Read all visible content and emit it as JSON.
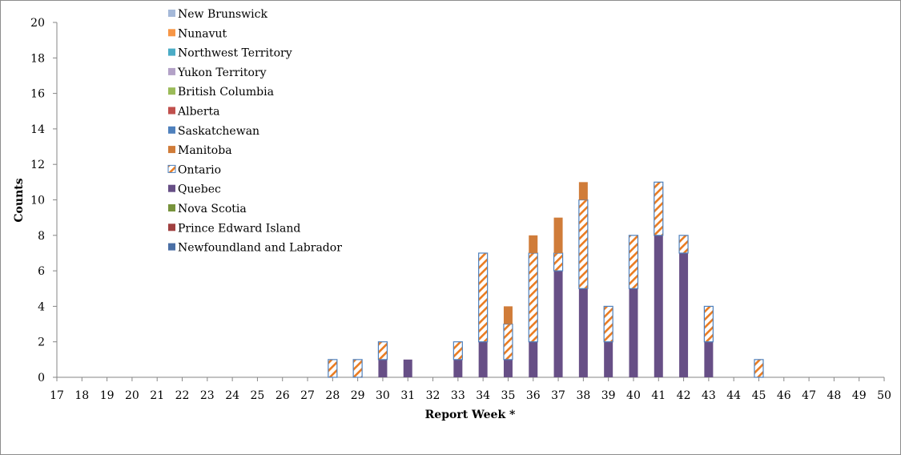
{
  "chart_data": {
    "type": "bar",
    "stacked": true,
    "title": "",
    "xlabel": "Report Week *",
    "ylabel": "Counts",
    "ylim": [
      0,
      20
    ],
    "yticks": [
      0,
      2,
      4,
      6,
      8,
      10,
      12,
      14,
      16,
      18,
      20
    ],
    "grid": false,
    "legend_position": "top-left",
    "categories": [
      "17",
      "18",
      "19",
      "20",
      "21",
      "22",
      "23",
      "24",
      "25",
      "26",
      "27",
      "28",
      "29",
      "30",
      "31",
      "32",
      "33",
      "34",
      "35",
      "36",
      "37",
      "38",
      "39",
      "40",
      "41",
      "42",
      "43",
      "44",
      "45",
      "46",
      "47",
      "48",
      "49",
      "50"
    ],
    "series": [
      {
        "name": "Newfoundland and Labrador",
        "color": "#4a6fa5",
        "pattern": "solid",
        "values": [
          0,
          0,
          0,
          0,
          0,
          0,
          0,
          0,
          0,
          0,
          0,
          0,
          0,
          0,
          0,
          0,
          0,
          0,
          0,
          0,
          0,
          0,
          0,
          0,
          0,
          0,
          0,
          0,
          0,
          0,
          0,
          0,
          0,
          0
        ]
      },
      {
        "name": "Prince Edward Island",
        "color": "#a04040",
        "pattern": "solid",
        "values": [
          0,
          0,
          0,
          0,
          0,
          0,
          0,
          0,
          0,
          0,
          0,
          0,
          0,
          0,
          0,
          0,
          0,
          0,
          0,
          0,
          0,
          0,
          0,
          0,
          0,
          0,
          0,
          0,
          0,
          0,
          0,
          0,
          0,
          0
        ]
      },
      {
        "name": "Nova Scotia",
        "color": "#77933c",
        "pattern": "solid",
        "values": [
          0,
          0,
          0,
          0,
          0,
          0,
          0,
          0,
          0,
          0,
          0,
          0,
          0,
          0,
          0,
          0,
          0,
          0,
          0,
          0,
          0,
          0,
          0,
          0,
          0,
          0,
          0,
          0,
          0,
          0,
          0,
          0,
          0,
          0
        ]
      },
      {
        "name": "Quebec",
        "color": "#674f86",
        "pattern": "solid",
        "values": [
          0,
          0,
          0,
          0,
          0,
          0,
          0,
          0,
          0,
          0,
          0,
          0,
          0,
          1,
          1,
          0,
          1,
          2,
          1,
          2,
          6,
          5,
          2,
          5,
          8,
          7,
          2,
          0,
          0,
          0,
          0,
          0,
          0,
          0
        ]
      },
      {
        "name": "Ontario",
        "color": "#e97c22",
        "pattern": "hatched",
        "border": "#4f81bd",
        "values": [
          0,
          0,
          0,
          0,
          0,
          0,
          0,
          0,
          0,
          0,
          0,
          1,
          1,
          1,
          0,
          0,
          1,
          5,
          2,
          5,
          1,
          5,
          2,
          3,
          3,
          1,
          2,
          0,
          1,
          0,
          0,
          0,
          0,
          0
        ]
      },
      {
        "name": "Manitoba",
        "color": "#d07c39",
        "pattern": "solid",
        "values": [
          0,
          0,
          0,
          0,
          0,
          0,
          0,
          0,
          0,
          0,
          0,
          0,
          0,
          0,
          0,
          0,
          0,
          0,
          1,
          1,
          2,
          1,
          0,
          0,
          0,
          0,
          0,
          0,
          0,
          0,
          0,
          0,
          0,
          0
        ]
      },
      {
        "name": "Saskatchewan",
        "color": "#4f81bd",
        "pattern": "solid",
        "values": [
          0,
          0,
          0,
          0,
          0,
          0,
          0,
          0,
          0,
          0,
          0,
          0,
          0,
          0,
          0,
          0,
          0,
          0,
          0,
          0,
          0,
          0,
          0,
          0,
          0,
          0,
          0,
          0,
          0,
          0,
          0,
          0,
          0,
          0
        ]
      },
      {
        "name": "Alberta",
        "color": "#c0504d",
        "pattern": "solid",
        "values": [
          0,
          0,
          0,
          0,
          0,
          0,
          0,
          0,
          0,
          0,
          0,
          0,
          0,
          0,
          0,
          0,
          0,
          0,
          0,
          0,
          0,
          0,
          0,
          0,
          0,
          0,
          0,
          0,
          0,
          0,
          0,
          0,
          0,
          0
        ]
      },
      {
        "name": "British Columbia",
        "color": "#9bbb59",
        "pattern": "solid",
        "values": [
          0,
          0,
          0,
          0,
          0,
          0,
          0,
          0,
          0,
          0,
          0,
          0,
          0,
          0,
          0,
          0,
          0,
          0,
          0,
          0,
          0,
          0,
          0,
          0,
          0,
          0,
          0,
          0,
          0,
          0,
          0,
          0,
          0,
          0
        ]
      },
      {
        "name": "Yukon Territory",
        "color": "#b3a2c7",
        "pattern": "solid",
        "values": [
          0,
          0,
          0,
          0,
          0,
          0,
          0,
          0,
          0,
          0,
          0,
          0,
          0,
          0,
          0,
          0,
          0,
          0,
          0,
          0,
          0,
          0,
          0,
          0,
          0,
          0,
          0,
          0,
          0,
          0,
          0,
          0,
          0,
          0
        ]
      },
      {
        "name": "Northwest Territory",
        "color": "#4bacc6",
        "pattern": "solid",
        "values": [
          0,
          0,
          0,
          0,
          0,
          0,
          0,
          0,
          0,
          0,
          0,
          0,
          0,
          0,
          0,
          0,
          0,
          0,
          0,
          0,
          0,
          0,
          0,
          0,
          0,
          0,
          0,
          0,
          0,
          0,
          0,
          0,
          0,
          0
        ]
      },
      {
        "name": "Nunavut",
        "color": "#f79646",
        "pattern": "solid",
        "values": [
          0,
          0,
          0,
          0,
          0,
          0,
          0,
          0,
          0,
          0,
          0,
          0,
          0,
          0,
          0,
          0,
          0,
          0,
          0,
          0,
          0,
          0,
          0,
          0,
          0,
          0,
          0,
          0,
          0,
          0,
          0,
          0,
          0,
          0
        ]
      },
      {
        "name": "New Brunswick",
        "color": "#a5b9d9",
        "pattern": "solid",
        "values": [
          0,
          0,
          0,
          0,
          0,
          0,
          0,
          0,
          0,
          0,
          0,
          0,
          0,
          0,
          0,
          0,
          0,
          0,
          0,
          0,
          0,
          0,
          0,
          0,
          0,
          0,
          0,
          0,
          0,
          0,
          0,
          0,
          0,
          0
        ]
      }
    ],
    "legend_order": [
      "New Brunswick",
      "Nunavut",
      "Northwest Territory",
      "Yukon Territory",
      "British Columbia",
      "Alberta",
      "Saskatchewan",
      "Manitoba",
      "Ontario",
      "Quebec",
      "Nova Scotia",
      "Prince Edward Island",
      "Newfoundland and Labrador"
    ]
  },
  "colors": {
    "axis": "#868686",
    "ontario_border": "#4f81bd",
    "ontario_hatch": "#e97c22"
  }
}
